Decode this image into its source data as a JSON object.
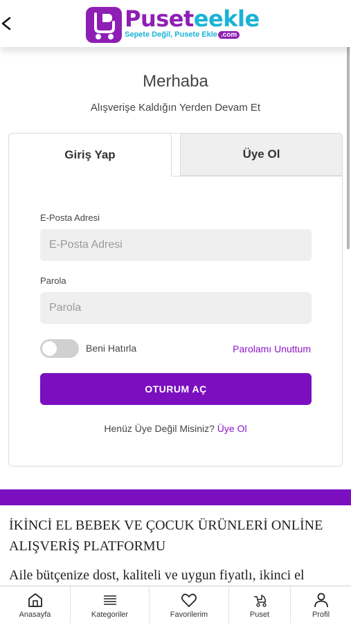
{
  "header": {
    "brand_part1": "Puset",
    "brand_part2": "eekle",
    "tagline": "Sepete Değil, Pusete Ekle",
    "tagline_com": ".com"
  },
  "greeting": {
    "title": "Merhaba",
    "subtitle": "Alışverişe Kaldığın Yerden Devam Et"
  },
  "tabs": {
    "login": "Giriş Yap",
    "register": "Üye Ol",
    "active": "login"
  },
  "form": {
    "email_label": "E-Posta Adresi",
    "email_placeholder": "E-Posta Adresi",
    "email_value": "",
    "password_label": "Parola",
    "password_placeholder": "Parola",
    "password_value": "",
    "remember_label": "Beni Hatırla",
    "remember_on": false,
    "forgot_label": "Parolamı Unuttum",
    "submit_label": "OTURUM AÇ",
    "no_account_text": "Henüz Üye Değil Misiniz?",
    "no_account_link": "Üye Ol"
  },
  "content": {
    "heading": "İKİNCİ EL BEBEK VE ÇOCUK ÜRÜNLERİ ONLİNE ALIŞVERİŞ PLATFORMU",
    "paragraph": "Aile bütçenize dost, kaliteli ve uygun fiyatlı, ikinci el"
  },
  "bottom_nav": [
    {
      "label": "Anasayfa",
      "icon": "home-icon"
    },
    {
      "label": "Kategoriler",
      "icon": "menu-icon"
    },
    {
      "label": "Favorilerim",
      "icon": "heart-icon"
    },
    {
      "label": "Puset",
      "icon": "stroller-icon"
    },
    {
      "label": "Profil",
      "icon": "user-icon"
    }
  ],
  "colors": {
    "accent": "#7b0fbf",
    "brand_purple": "#8e1fb4",
    "brand_blue": "#1ab3d6",
    "link": "#8a14c8"
  }
}
